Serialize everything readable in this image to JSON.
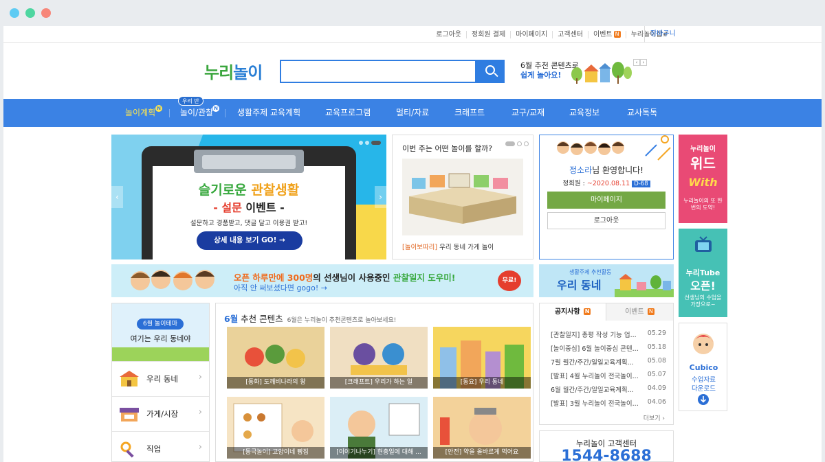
{
  "util": {
    "links": [
      "로그아웃",
      "정회원 결제",
      "마이페이지",
      "고객센터",
      "이벤트",
      "누리놀이샵#"
    ],
    "event_badge": "N",
    "cart": "장바구니"
  },
  "header": {
    "logo_a": "누리",
    "logo_b": "놀이",
    "search_placeholder": "",
    "promo_line1": "6월 추천 콘텐츠로",
    "promo_line2": "쉽게 놀아요!",
    "prev": "‹",
    "next": "›"
  },
  "nav": {
    "badge": "우리 반",
    "new_badge": "N",
    "items": [
      "놀이계획",
      "놀이/관찰",
      "생활주제 교육계획",
      "교육프로그램",
      "멀티/자료",
      "크래프트",
      "교구/교재",
      "교육정보",
      "교사톡톡"
    ]
  },
  "banner": {
    "title_a": "슬기로운",
    "title_b": "관찰생활",
    "sub_a": "- 설문",
    "sub_b": " 이벤트 -",
    "desc": "설문하고 경품받고, 댓글 달고 이용권 받고!",
    "button": "상세 내용 보기 GO! →",
    "prev": "‹",
    "next": "›"
  },
  "week": {
    "title": "이번 주는 어떤 놀이를 할까?",
    "caption_tag": "[놀이보따리]",
    "caption": " 우리 동네 가게 놀이"
  },
  "welcome": {
    "name": "정소라",
    "greeting": "님 환영합니다!",
    "member_label": "정회원 : ",
    "member_date": "~2020.08.11",
    "dday": "D-68",
    "mypage": "마이페이지",
    "logout": "로그아웃"
  },
  "side": {
    "wid_top": "누리놀이",
    "wid_big": "위드",
    "wid_logo": "With",
    "wid_desc": "누리놀이의 또 한번의 도약!",
    "tube_top": "누리Tube",
    "tube_big": "오픈!",
    "tube_desc": "선생님의 수업을 가장으로~",
    "cubico": "Cubico",
    "cubico_desc1": "수업자료",
    "cubico_desc2": "다운로드"
  },
  "strip": {
    "l1_a": "오픈 하루만에 300명",
    "l1_b": "의 선생님이 사용중인 ",
    "l1_c": "관찰일지 도우미!",
    "l2": "아직 안 써보셨다면 gogo! →",
    "free": "무료!"
  },
  "village": {
    "small": "생활주제 추천활동",
    "big": "우리 동네"
  },
  "theme": {
    "tag": "6월 놀이테마",
    "title": "여기는 우리 동네야",
    "rows": [
      "우리 동네",
      "가게/시장",
      "직업"
    ],
    "chevron": "›"
  },
  "rec": {
    "month": "6월",
    "title": " 추천 콘텐츠",
    "sub": "6월은 누리놀이 추천콘텐츠로 놀아보세요!",
    "items": [
      "[동화] 도깨비나라의 왕",
      "[크래프트] 우리가 하는 일",
      "[동요] 우리 동네",
      "[동극놀이] 고양이네 빵집",
      "[이야기나누기] 현충일에 대해 ...",
      "[안전] 약을 올바르게 먹어요"
    ]
  },
  "notice": {
    "tab_notice": "공지사항",
    "tab_event": "이벤트",
    "badge": "N",
    "items": [
      {
        "t": "[관찰일지] 총평 작성 기능 업...",
        "d": "05.29"
      },
      {
        "t": "[놀이중심] 6월 놀이중심 콘텐...",
        "d": "05.18"
      },
      {
        "t": "7월 월간/주간/일일교육계획...",
        "d": "05.08"
      },
      {
        "t": "[발표] 4월 누리놀이 전국놀이...",
        "d": "05.07"
      },
      {
        "t": "6월 월간/주간/일일교육계획...",
        "d": "04.09"
      },
      {
        "t": "[발표] 3월 누리놀이 전국놀이...",
        "d": "04.06"
      }
    ],
    "more": "더보기 ›"
  },
  "cs": {
    "title": "누리놀이 고객센터",
    "phone": "1544-8688"
  }
}
